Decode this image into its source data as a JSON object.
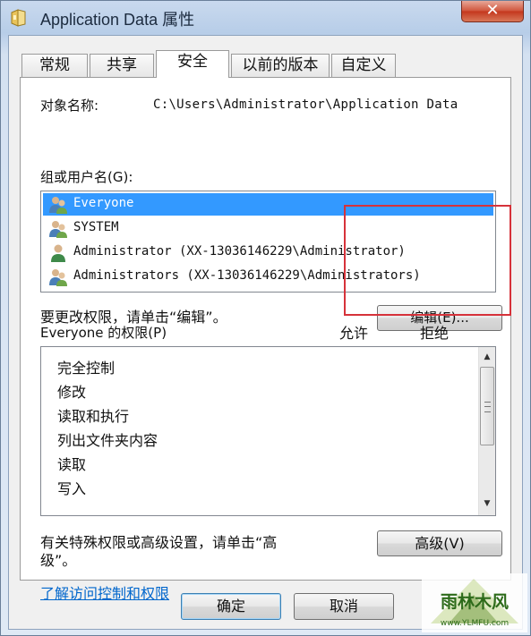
{
  "window": {
    "title": "Application Data 属性",
    "close_label": "✕"
  },
  "tabs": [
    {
      "label": "常规"
    },
    {
      "label": "共享"
    },
    {
      "label": "安全",
      "active": true
    },
    {
      "label": "以前的版本"
    },
    {
      "label": "自定义"
    }
  ],
  "security": {
    "object_name_label": "对象名称:",
    "object_name_value": "C:\\Users\\Administrator\\Application Data",
    "groups_label": "组或用户名(G):",
    "groups": [
      {
        "name": "Everyone",
        "icon": "group-users-icon",
        "selected": true
      },
      {
        "name": "SYSTEM",
        "icon": "group-users-icon",
        "selected": false
      },
      {
        "name": "Administrator  (XX-13036146229\\Administrator)",
        "icon": "user-icon",
        "selected": false
      },
      {
        "name": "Administrators  (XX-13036146229\\Administrators)",
        "icon": "group-users-icon",
        "selected": false
      }
    ],
    "change_hint": "要更改权限，请单击“编辑”。",
    "edit_button": "编辑(E)...",
    "perm_label": "Everyone 的权限(P)",
    "allow_header": "允许",
    "deny_header": "拒绝",
    "permissions": [
      "完全控制",
      "修改",
      "读取和执行",
      "列出文件夹内容",
      "读取",
      "写入"
    ],
    "advanced_hint_line1": "有关特殊权限或高级设置，请单击“高",
    "advanced_hint_line2": "级”。",
    "advanced_button": "高级(V)",
    "learn_link": "了解访问控制和权限"
  },
  "footer": {
    "ok_button": "确定",
    "cancel_button": "取消"
  },
  "watermark": {
    "brand": "雨林木风",
    "url": "www.YLMFU.com"
  },
  "colors": {
    "selection": "#3399ff",
    "highlight_box": "#d6323a",
    "link": "#0066cc"
  }
}
